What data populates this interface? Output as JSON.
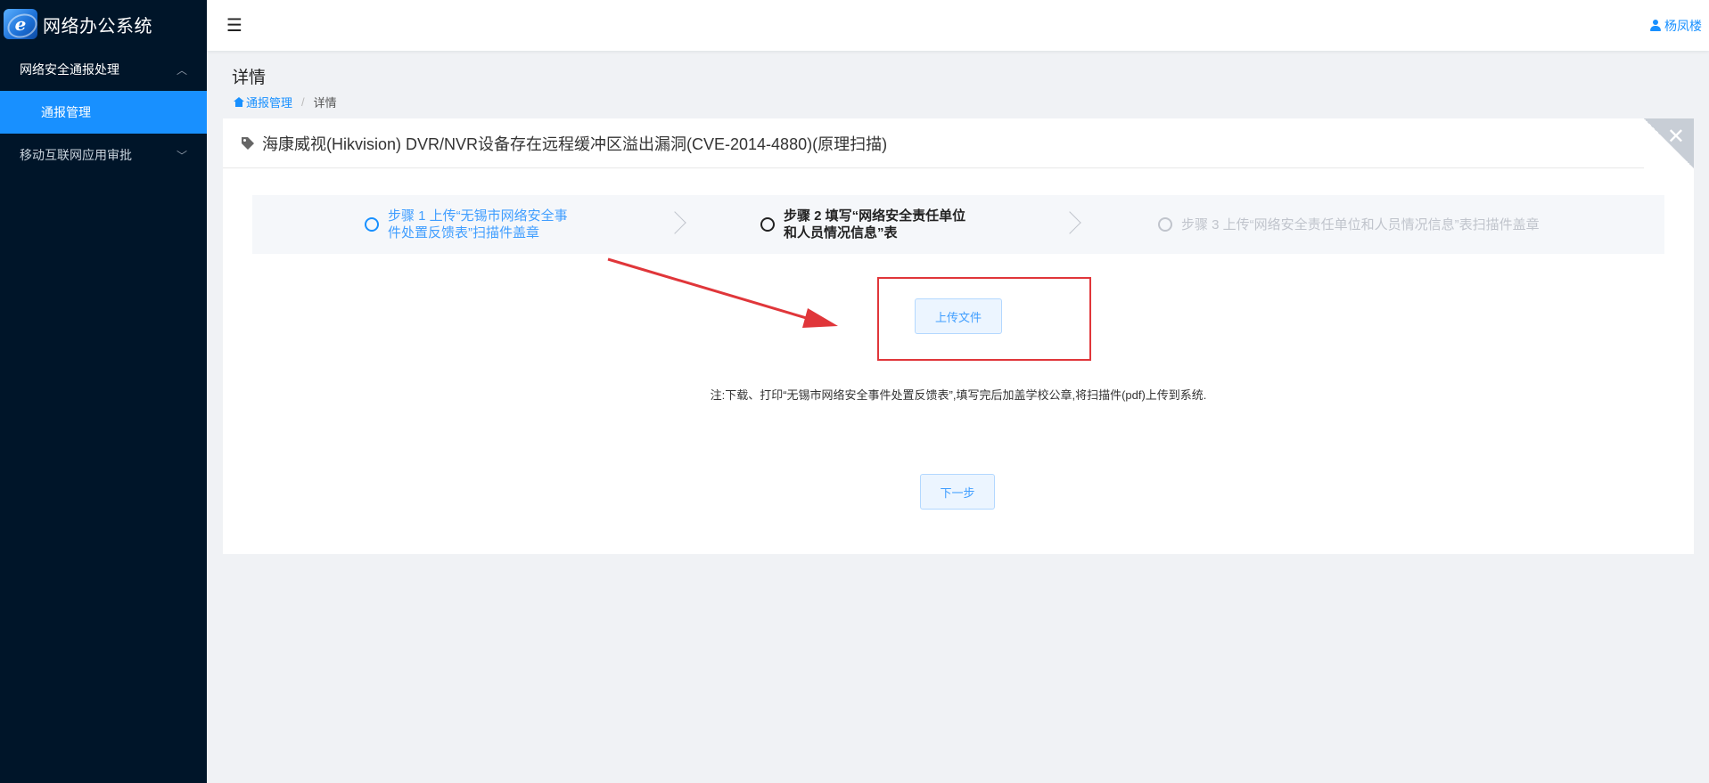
{
  "app": {
    "title": "网络办公系统"
  },
  "sidebar": {
    "items": [
      {
        "label": "网络安全通报处理",
        "expanded": true,
        "children": [
          {
            "label": "通报管理",
            "active": true
          }
        ]
      },
      {
        "label": "移动互联网应用审批",
        "expanded": false
      }
    ]
  },
  "header": {
    "user_name": "杨凤楼"
  },
  "page": {
    "title": "详情",
    "breadcrumb": {
      "home": "通报管理",
      "current": "详情"
    }
  },
  "card": {
    "title": "海康威视(Hikvision) DVR/NVR设备存在远程缓冲区溢出漏洞(CVE-2014-4880)(原理扫描)"
  },
  "steps": [
    {
      "label": "步骤 1 上传“无锡市网络安全事件处置反馈表”扫描件盖章",
      "status": "done"
    },
    {
      "label": "步骤 2 填写“网络安全责任单位和人员情况信息”表",
      "status": "current"
    },
    {
      "label": "步骤 3 上传“网络安全责任单位和人员情况信息”表扫描件盖章",
      "status": "pending"
    }
  ],
  "upload": {
    "button_label": "上传文件"
  },
  "note": "注:下载、打印“无锡市网络安全事件处置反馈表”,填写完后加盖学校公章,将扫描件(pdf)上传到系统.",
  "next": {
    "button_label": "下一步"
  },
  "colors": {
    "sidebar_bg": "#001529",
    "accent": "#1890ff",
    "highlight": "#e0363a"
  }
}
